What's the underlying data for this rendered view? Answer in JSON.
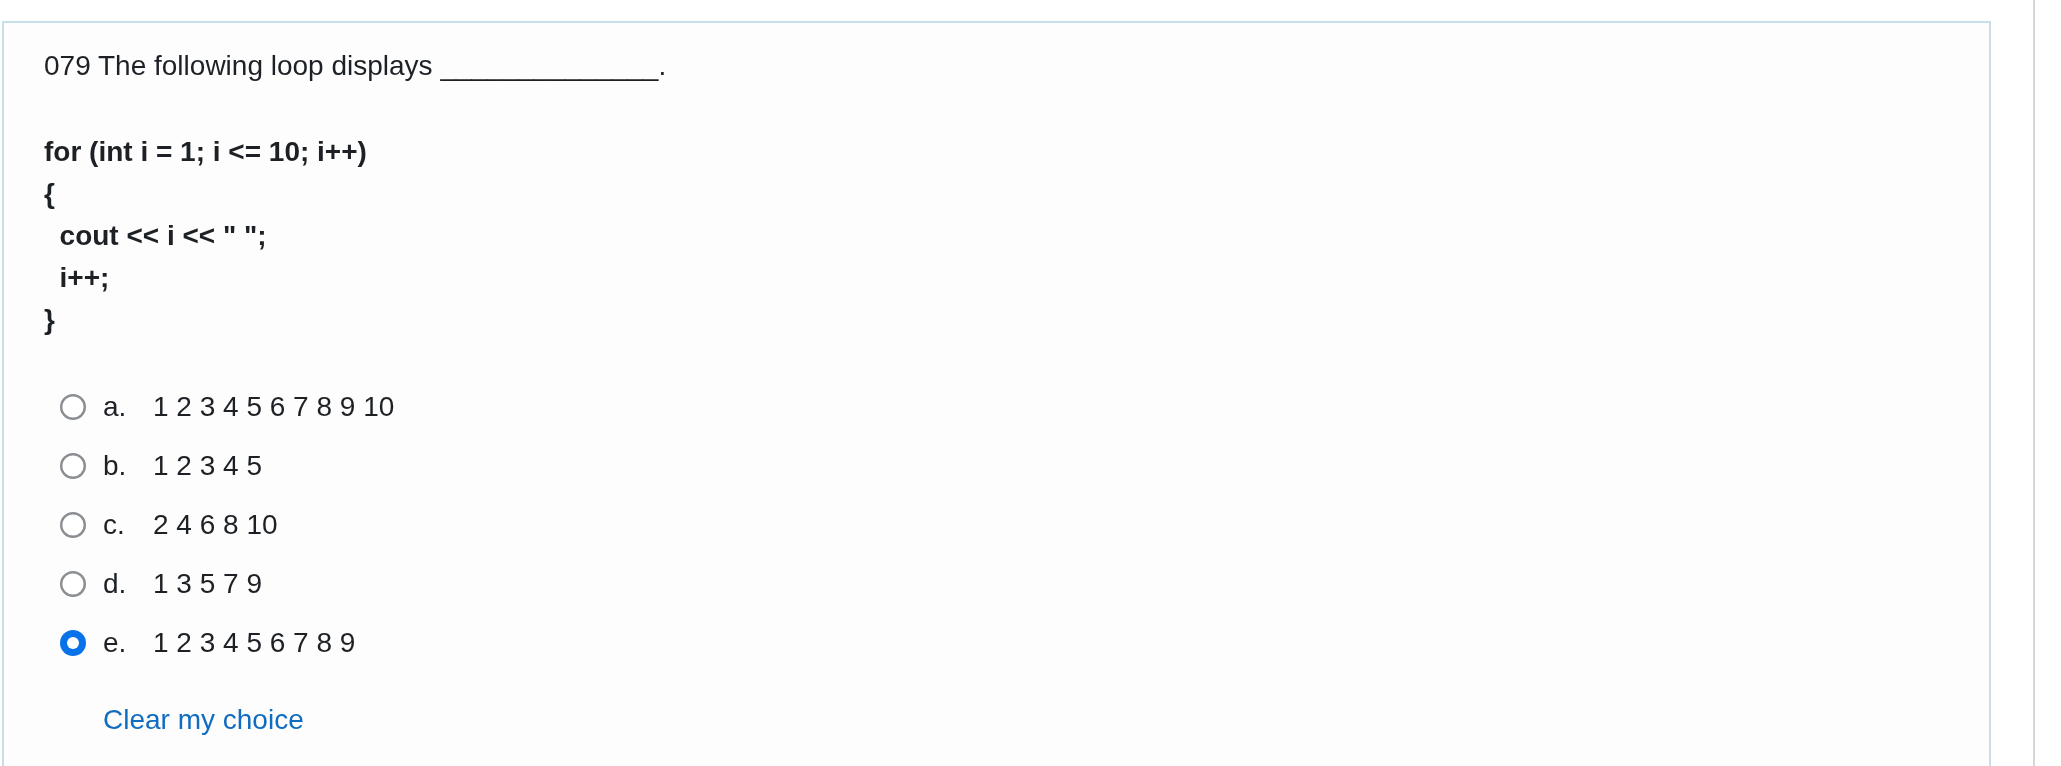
{
  "question": {
    "text": "079 The following loop displays ______________."
  },
  "code": {
    "lines": [
      "for (int i = 1; i <= 10; i++)",
      "{",
      "  cout << i << \" \";",
      "  i++;",
      "}"
    ]
  },
  "options": [
    {
      "letter": "a.",
      "text": "1 2 3 4 5 6 7 8 9 10",
      "selected": false
    },
    {
      "letter": "b.",
      "text": "1 2 3 4 5",
      "selected": false
    },
    {
      "letter": "c.",
      "text": "2 4 6 8 10",
      "selected": false
    },
    {
      "letter": "d.",
      "text": "1 3 5 7 9",
      "selected": false
    },
    {
      "letter": "e.",
      "text": "1 2 3 4 5 6 7 8 9",
      "selected": true
    }
  ],
  "clear_choice": {
    "label": "Clear my choice"
  }
}
